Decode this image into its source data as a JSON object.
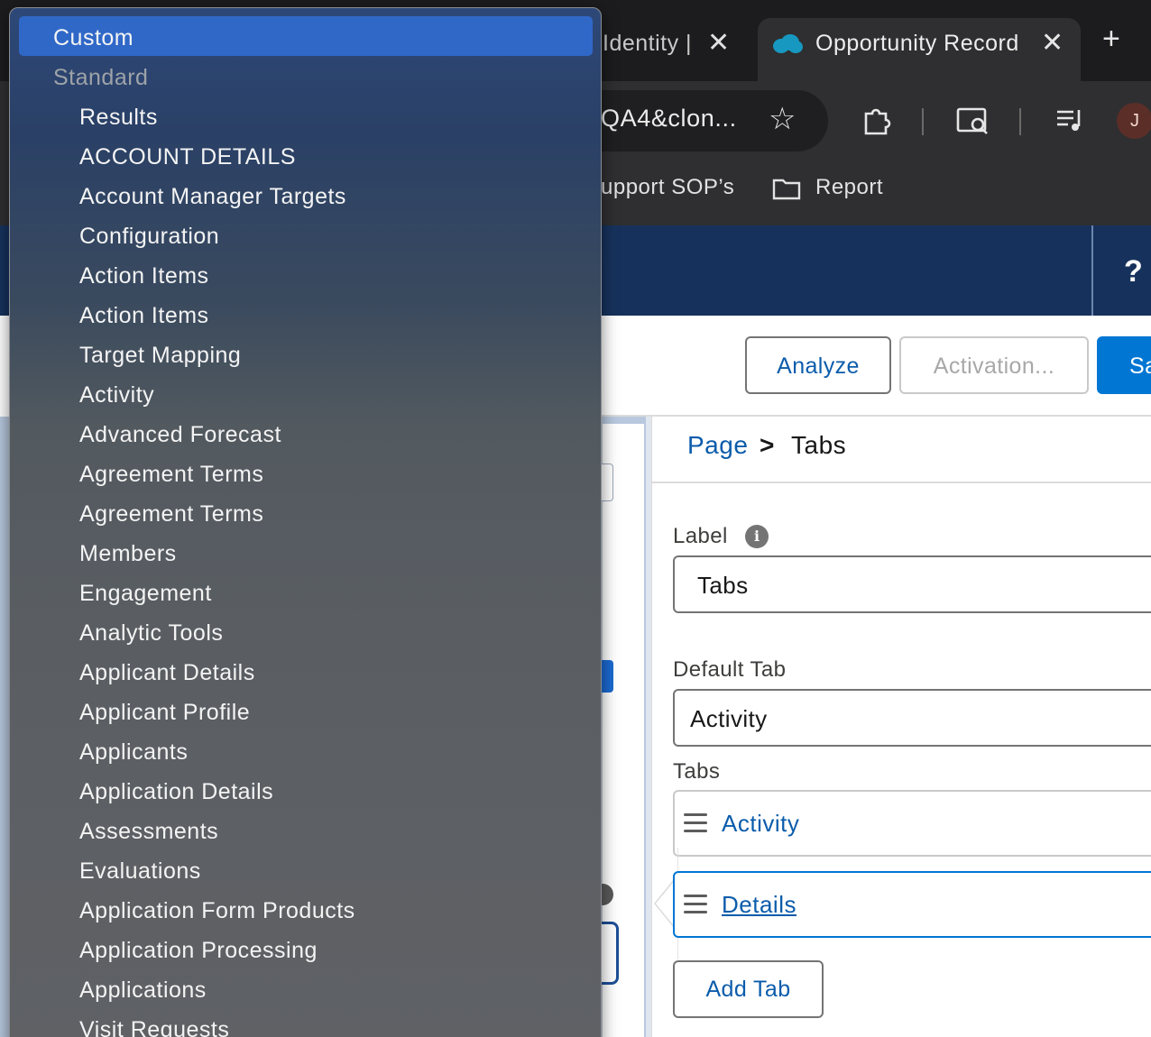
{
  "browser": {
    "tabs": [
      {
        "title": "Identity |",
        "close": "✕"
      },
      {
        "title": "Opportunity Record",
        "close": "✕"
      }
    ],
    "new_tab": "+",
    "address": "QA4&clon...",
    "avatar_initial": "J",
    "bookmarks": [
      {
        "label": "upport SOP’s"
      },
      {
        "label": "Report"
      }
    ]
  },
  "header": {
    "help_icon": "?"
  },
  "actions": {
    "analyze": "Analyze",
    "activation": "Activation...",
    "save": "Sa"
  },
  "properties": {
    "breadcrumb": {
      "page": "Page",
      "separator": ">",
      "current": "Tabs"
    },
    "label_field": {
      "label": "Label",
      "info_icon": "i",
      "value": "Tabs"
    },
    "default_tab_field": {
      "label": "Default Tab",
      "value": "Activity"
    },
    "tabs_section": {
      "label": "Tabs",
      "items": [
        {
          "label": "Activity"
        },
        {
          "label": "Details"
        }
      ]
    },
    "add_tab": "Add Tab"
  },
  "dropdown": {
    "options": [
      {
        "label": "Custom"
      },
      {
        "label": "Standard"
      },
      {
        "label": "Results"
      },
      {
        "label": "ACCOUNT DETAILS"
      },
      {
        "label": "Account Manager Targets"
      },
      {
        "label": "Configuration"
      },
      {
        "label": "Action Items"
      },
      {
        "label": "Action Items"
      },
      {
        "label": "Target Mapping"
      },
      {
        "label": "Activity"
      },
      {
        "label": "Advanced Forecast"
      },
      {
        "label": "Agreement Terms"
      },
      {
        "label": "Agreement Terms"
      },
      {
        "label": "Members"
      },
      {
        "label": "Engagement"
      },
      {
        "label": "Analytic Tools"
      },
      {
        "label": "Applicant Details"
      },
      {
        "label": "Applicant Profile"
      },
      {
        "label": "Applicants"
      },
      {
        "label": "Application Details"
      },
      {
        "label": "Assessments"
      },
      {
        "label": "Evaluations"
      },
      {
        "label": "Application Form Products"
      },
      {
        "label": "Application Processing"
      },
      {
        "label": "Applications"
      },
      {
        "label": "Visit Requests"
      }
    ]
  }
}
